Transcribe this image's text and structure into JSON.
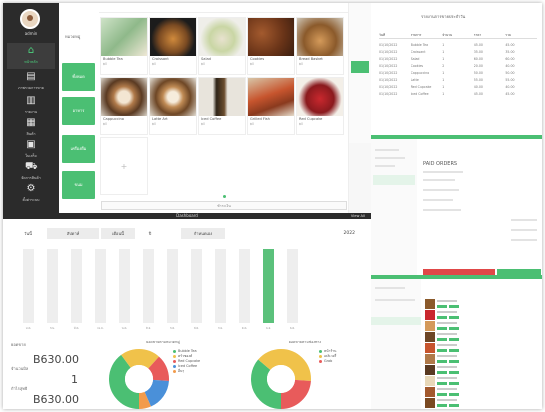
{
  "sidebar": {
    "user_name": "admin",
    "items": [
      {
        "label": "หน้าหลัก",
        "icon": "home-icon",
        "active": true
      },
      {
        "label": "ภาพรวมการขาย",
        "icon": "sales-report-icon"
      },
      {
        "label": "รายงาน",
        "icon": "chart-icon"
      },
      {
        "label": "สินค้า",
        "icon": "products-icon"
      },
      {
        "label": "ใบเสร็จ",
        "icon": "receipt-icon"
      },
      {
        "label": "จัดการสินค้า",
        "icon": "cart-icon"
      },
      {
        "label": "ตั้งค่าระบบ",
        "icon": "settings-icon"
      }
    ]
  },
  "categories": {
    "title": "หมวดหมู่",
    "items": [
      "ทั้งหมด",
      "อาหาร",
      "เครื่องดื่ม",
      "ขนม"
    ]
  },
  "products": {
    "items": [
      {
        "name": "Bubble Tea",
        "price": "฿0"
      },
      {
        "name": "Croissant",
        "price": "฿0"
      },
      {
        "name": "Salad",
        "price": "฿0"
      },
      {
        "name": "Cookies",
        "price": "฿0"
      },
      {
        "name": "Bread Basket",
        "price": "฿0"
      },
      {
        "name": "Cappuccino",
        "price": "฿0"
      },
      {
        "name": "Latte Art",
        "price": "฿0"
      },
      {
        "name": "Iced Coffee",
        "price": "฿0"
      },
      {
        "name": "Grilled Fish",
        "price": "฿0"
      },
      {
        "name": "Red Cupcake",
        "price": "฿0"
      }
    ],
    "add_symbol": "+",
    "bottom_button": "ชำระเงิน"
  },
  "report": {
    "title": "รายงานการขายประจำวัน",
    "columns": [
      "วันที่",
      "รายการ",
      "จำนวน",
      "ราคา",
      "รวม"
    ],
    "rows": [
      [
        "01/10/2022",
        "Bubble Tea",
        "1",
        "45.00",
        "45.00"
      ],
      [
        "01/10/2022",
        "Croissant",
        "1",
        "35.00",
        "35.00"
      ],
      [
        "01/10/2022",
        "Salad",
        "1",
        "60.00",
        "60.00"
      ],
      [
        "01/10/2022",
        "Cookies",
        "2",
        "20.00",
        "40.00"
      ],
      [
        "01/10/2022",
        "Cappuccino",
        "1",
        "50.00",
        "50.00"
      ],
      [
        "01/10/2022",
        "Latte",
        "1",
        "55.00",
        "55.00"
      ],
      [
        "01/10/2022",
        "Red Cupcake",
        "1",
        "40.00",
        "40.00"
      ],
      [
        "01/10/2022",
        "Iced Coffee",
        "1",
        "45.00",
        "45.00"
      ]
    ]
  },
  "receipt": {
    "title": "PAID ORDERS"
  },
  "dashboard": {
    "title": "Dashboard",
    "link": "View All",
    "segments": [
      "วันนี้",
      "สัปดาห์",
      "เดือนนี้",
      "ปี",
      "กำหนดเอง"
    ],
    "year": "2022",
    "stats": [
      {
        "label": "ยอดขาย",
        "value": "B630.00"
      },
      {
        "label": "จำนวนบิล",
        "value": "1"
      },
      {
        "label": "กำไรสุทธิ",
        "value": "B630.00"
      }
    ],
    "donut1_title": "ยอดขายตามหมวดหมู่",
    "donut2_title": "ยอดขายตามช่องทาง",
    "donut1_legend": [
      {
        "label": "Bubble Tea",
        "color": "#4bbf73"
      },
      {
        "label": "ครัวซองต์",
        "color": "#f0c24a"
      },
      {
        "label": "Red Cupcake",
        "color": "#e85b5b"
      },
      {
        "label": "Iced Coffee",
        "color": "#4a90d9"
      },
      {
        "label": "อื่นๆ",
        "color": "#f29b4b"
      }
    ],
    "donut2_legend": [
      {
        "label": "หน้าร้าน",
        "color": "#4bbf73"
      },
      {
        "label": "เดลิเวอรี่",
        "color": "#f0c24a"
      },
      {
        "label": "Grab",
        "color": "#e85b5b"
      }
    ]
  },
  "chart_data": {
    "type": "bar",
    "categories": [
      "ม.ค.",
      "ก.พ.",
      "มี.ค.",
      "เม.ย.",
      "พ.ค.",
      "มิ.ย.",
      "ก.ค.",
      "ส.ค.",
      "ก.ย.",
      "ต.ค.",
      "พ.ย.",
      "ธ.ค."
    ],
    "values": [
      0,
      0,
      0,
      0,
      0,
      0,
      0,
      0,
      0,
      0,
      630,
      0
    ],
    "ylim": [
      0,
      630
    ],
    "highlight_color": "#5bc17b",
    "background_color": "#eeeeee"
  }
}
